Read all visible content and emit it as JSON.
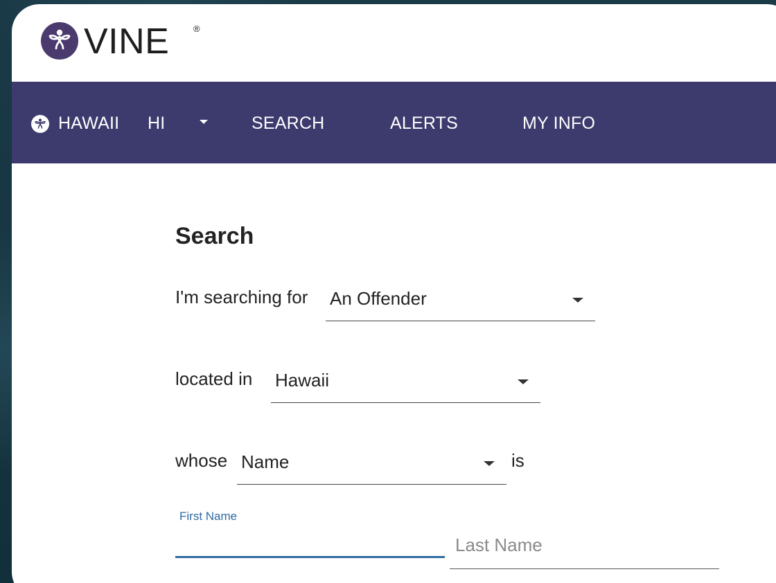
{
  "brand": {
    "name": "VINE",
    "registered": "®"
  },
  "nav": {
    "state_name": "HAWAII",
    "state_code": "HI",
    "items": [
      {
        "label": "SEARCH"
      },
      {
        "label": "ALERTS"
      },
      {
        "label": "MY INFO"
      }
    ]
  },
  "search": {
    "title": "Search",
    "searching_for_label": "I'm searching for",
    "searching_for_value": "An Offender",
    "located_in_label": "located in",
    "located_in_value": "Hawaii",
    "whose_label": "whose",
    "whose_value": "Name",
    "is_label": "is",
    "first_name_label": "First Name",
    "first_name_value": "",
    "last_name_placeholder": "Last Name"
  },
  "colors": {
    "brand_purple": "#3d3a6e",
    "focus_blue": "#2f6aa3"
  },
  "icons": {
    "logo": "vine-flower-logo-icon",
    "state": "vine-flower-badge-icon",
    "caret": "caret-down-icon"
  }
}
